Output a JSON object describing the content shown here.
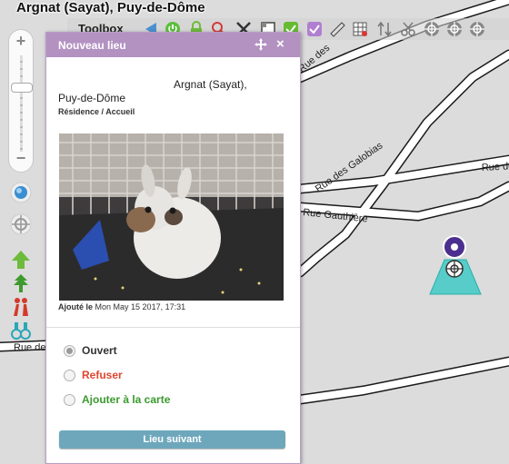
{
  "place_title": "Argnat (Sayat), Puy-de-Dôme",
  "toolbox": {
    "label": "Toolbox",
    "tools": [
      {
        "icon": "back-arrow-icon"
      },
      {
        "icon": "power-icon"
      },
      {
        "icon": "lock-icon"
      },
      {
        "icon": "search-pin-icon"
      },
      {
        "icon": "tools-icon"
      },
      {
        "icon": "window-icon"
      },
      {
        "icon": "check-green-icon"
      },
      {
        "icon": "check-purple-icon"
      },
      {
        "icon": "ruler-icon"
      },
      {
        "icon": "grid-icon"
      },
      {
        "icon": "sort-arrows-icon"
      },
      {
        "icon": "scissors-icon"
      },
      {
        "icon": "target-icon"
      },
      {
        "icon": "target-icon"
      },
      {
        "icon": "target-icon"
      }
    ]
  },
  "map": {
    "streets": [
      "Rue des",
      "Rue des Galobias",
      "Rue de",
      "Rue Gauthière",
      "Rue de"
    ]
  },
  "popup": {
    "title": "Nouveau lieu",
    "close": "×",
    "address_line1": "Argnat (Sayat),",
    "address_line2": "Puy-de-Dôme",
    "category": "Résidence / Accueil",
    "added_label": "Ajouté le",
    "added_date": "Mon May 15 2017, 17:31",
    "options": [
      {
        "label": "Ouvert",
        "selected": true,
        "color": "#333333"
      },
      {
        "label": "Refuser",
        "selected": false,
        "color": "#e0452e"
      },
      {
        "label": "Ajouter à la carte",
        "selected": false,
        "color": "#3b9a2e"
      }
    ],
    "next_button": "Lieu suivant"
  },
  "zoom": {
    "plus": "+",
    "minus": "−"
  },
  "colors": {
    "header": "#b392c2",
    "button": "#6ea7bc",
    "map_bg": "#dcdcdc",
    "road_fill": "#ffffff",
    "road_edge": "#1b1b1b",
    "marker": "#3fc9c4"
  }
}
